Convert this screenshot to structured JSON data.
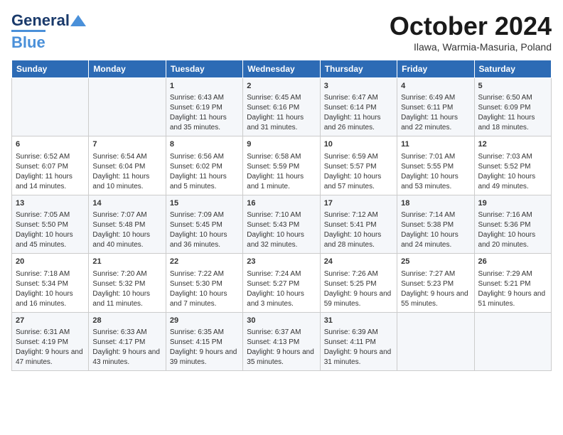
{
  "header": {
    "logo_general": "General",
    "logo_blue": "Blue",
    "month": "October 2024",
    "location": "Ilawa, Warmia-Masuria, Poland"
  },
  "days_of_week": [
    "Sunday",
    "Monday",
    "Tuesday",
    "Wednesday",
    "Thursday",
    "Friday",
    "Saturday"
  ],
  "weeks": [
    [
      {
        "day": "",
        "info": ""
      },
      {
        "day": "",
        "info": ""
      },
      {
        "day": "1",
        "sunrise": "6:43 AM",
        "sunset": "6:19 PM",
        "daylight": "11 hours and 35 minutes."
      },
      {
        "day": "2",
        "sunrise": "6:45 AM",
        "sunset": "6:16 PM",
        "daylight": "11 hours and 31 minutes."
      },
      {
        "day": "3",
        "sunrise": "6:47 AM",
        "sunset": "6:14 PM",
        "daylight": "11 hours and 26 minutes."
      },
      {
        "day": "4",
        "sunrise": "6:49 AM",
        "sunset": "6:11 PM",
        "daylight": "11 hours and 22 minutes."
      },
      {
        "day": "5",
        "sunrise": "6:50 AM",
        "sunset": "6:09 PM",
        "daylight": "11 hours and 18 minutes."
      }
    ],
    [
      {
        "day": "6",
        "sunrise": "6:52 AM",
        "sunset": "6:07 PM",
        "daylight": "11 hours and 14 minutes."
      },
      {
        "day": "7",
        "sunrise": "6:54 AM",
        "sunset": "6:04 PM",
        "daylight": "11 hours and 10 minutes."
      },
      {
        "day": "8",
        "sunrise": "6:56 AM",
        "sunset": "6:02 PM",
        "daylight": "11 hours and 5 minutes."
      },
      {
        "day": "9",
        "sunrise": "6:58 AM",
        "sunset": "5:59 PM",
        "daylight": "11 hours and 1 minute."
      },
      {
        "day": "10",
        "sunrise": "6:59 AM",
        "sunset": "5:57 PM",
        "daylight": "10 hours and 57 minutes."
      },
      {
        "day": "11",
        "sunrise": "7:01 AM",
        "sunset": "5:55 PM",
        "daylight": "10 hours and 53 minutes."
      },
      {
        "day": "12",
        "sunrise": "7:03 AM",
        "sunset": "5:52 PM",
        "daylight": "10 hours and 49 minutes."
      }
    ],
    [
      {
        "day": "13",
        "sunrise": "7:05 AM",
        "sunset": "5:50 PM",
        "daylight": "10 hours and 45 minutes."
      },
      {
        "day": "14",
        "sunrise": "7:07 AM",
        "sunset": "5:48 PM",
        "daylight": "10 hours and 40 minutes."
      },
      {
        "day": "15",
        "sunrise": "7:09 AM",
        "sunset": "5:45 PM",
        "daylight": "10 hours and 36 minutes."
      },
      {
        "day": "16",
        "sunrise": "7:10 AM",
        "sunset": "5:43 PM",
        "daylight": "10 hours and 32 minutes."
      },
      {
        "day": "17",
        "sunrise": "7:12 AM",
        "sunset": "5:41 PM",
        "daylight": "10 hours and 28 minutes."
      },
      {
        "day": "18",
        "sunrise": "7:14 AM",
        "sunset": "5:38 PM",
        "daylight": "10 hours and 24 minutes."
      },
      {
        "day": "19",
        "sunrise": "7:16 AM",
        "sunset": "5:36 PM",
        "daylight": "10 hours and 20 minutes."
      }
    ],
    [
      {
        "day": "20",
        "sunrise": "7:18 AM",
        "sunset": "5:34 PM",
        "daylight": "10 hours and 16 minutes."
      },
      {
        "day": "21",
        "sunrise": "7:20 AM",
        "sunset": "5:32 PM",
        "daylight": "10 hours and 11 minutes."
      },
      {
        "day": "22",
        "sunrise": "7:22 AM",
        "sunset": "5:30 PM",
        "daylight": "10 hours and 7 minutes."
      },
      {
        "day": "23",
        "sunrise": "7:24 AM",
        "sunset": "5:27 PM",
        "daylight": "10 hours and 3 minutes."
      },
      {
        "day": "24",
        "sunrise": "7:26 AM",
        "sunset": "5:25 PM",
        "daylight": "9 hours and 59 minutes."
      },
      {
        "day": "25",
        "sunrise": "7:27 AM",
        "sunset": "5:23 PM",
        "daylight": "9 hours and 55 minutes."
      },
      {
        "day": "26",
        "sunrise": "7:29 AM",
        "sunset": "5:21 PM",
        "daylight": "9 hours and 51 minutes."
      }
    ],
    [
      {
        "day": "27",
        "sunrise": "6:31 AM",
        "sunset": "4:19 PM",
        "daylight": "9 hours and 47 minutes."
      },
      {
        "day": "28",
        "sunrise": "6:33 AM",
        "sunset": "4:17 PM",
        "daylight": "9 hours and 43 minutes."
      },
      {
        "day": "29",
        "sunrise": "6:35 AM",
        "sunset": "4:15 PM",
        "daylight": "9 hours and 39 minutes."
      },
      {
        "day": "30",
        "sunrise": "6:37 AM",
        "sunset": "4:13 PM",
        "daylight": "9 hours and 35 minutes."
      },
      {
        "day": "31",
        "sunrise": "6:39 AM",
        "sunset": "4:11 PM",
        "daylight": "9 hours and 31 minutes."
      },
      {
        "day": "",
        "info": ""
      },
      {
        "day": "",
        "info": ""
      }
    ]
  ]
}
